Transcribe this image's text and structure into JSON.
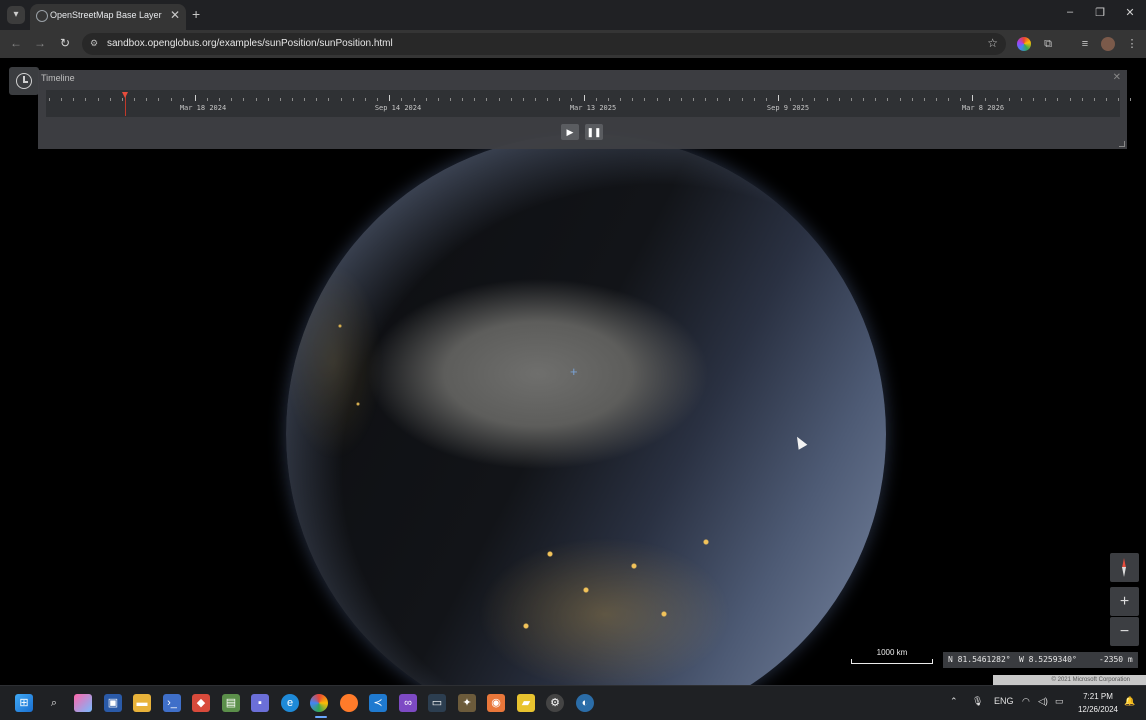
{
  "browser": {
    "tab_title": "OpenStreetMap Base Layer",
    "url": "sandbox.openglobus.org/examples/sunPosition/sunPosition.html"
  },
  "timeline": {
    "title": "Timeline",
    "labels": [
      "Mar 18 2024",
      "Sep 14 2024",
      "Mar 13 2025",
      "Sep 9 2025",
      "Mar 8 2026"
    ],
    "play_icon": "play-icon",
    "pause_icon": "pause-icon"
  },
  "map": {
    "scale_label": "1000 km",
    "coords": {
      "lat": "N 81.5461282°",
      "lon": "W 8.5259340°",
      "alt": "-2350 m"
    },
    "attribution": "© 2021 Microsoft Corporation",
    "zoom_in": "+",
    "zoom_out": "−"
  },
  "taskbar": {
    "language": "ENG",
    "time": "7:21 PM",
    "date": "12/26/2024"
  },
  "colors": {
    "accent": "#e74c3c",
    "panel": "#3e4044",
    "city_lights": "#f2c35a"
  }
}
